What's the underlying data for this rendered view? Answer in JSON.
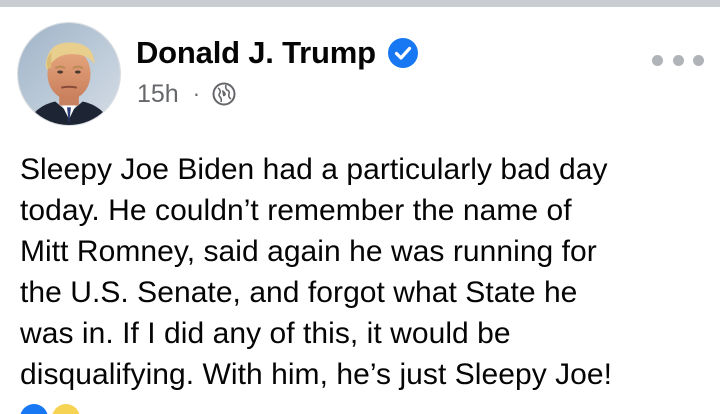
{
  "post": {
    "author": {
      "name": "Donald J. Trump",
      "verified": true,
      "avatar_icon": "profile-photo"
    },
    "meta": {
      "timestamp": "15h",
      "separator": "·",
      "audience_icon": "globe-icon"
    },
    "text": "Sleepy Joe Biden had a particularly bad day\ntoday. He couldn’t remember the name of\nMitt Romney, said again he was running for\nthe U.S. Senate, and forgot what State he\nwas in. If I did any of this, it would be\ndisqualifying. With him, he’s just Sleepy Joe!",
    "reactions": [
      "like-icon",
      "haha-icon"
    ]
  },
  "colors": {
    "divider": "#c9ccd1",
    "verified_badge": "#1877f2",
    "secondary_text": "#65676b",
    "primary_text": "#050505"
  }
}
